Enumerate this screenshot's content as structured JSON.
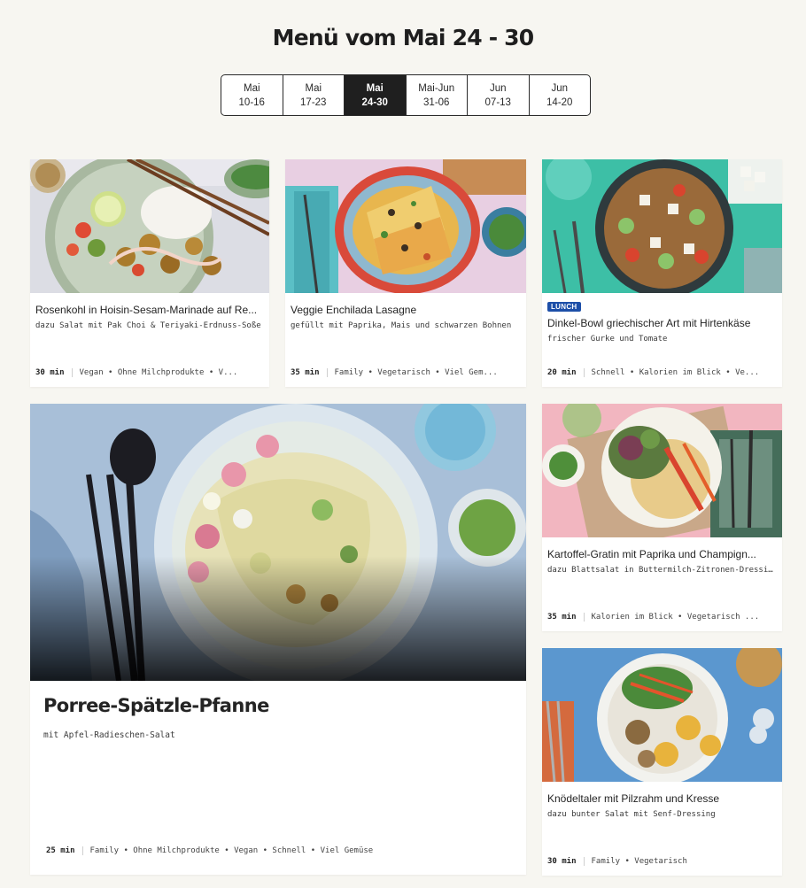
{
  "header": {
    "title": "Menü vom Mai 24 - 30"
  },
  "weeks": [
    {
      "month": "Mai",
      "range": "10-16",
      "active": false
    },
    {
      "month": "Mai",
      "range": "17-23",
      "active": false
    },
    {
      "month": "Mai",
      "range": "24-30",
      "active": true
    },
    {
      "month": "Mai-Jun",
      "range": "31-06",
      "active": false
    },
    {
      "month": "Jun",
      "range": "07-13",
      "active": false
    },
    {
      "month": "Jun",
      "range": "14-20",
      "active": false
    }
  ],
  "recipes": {
    "rosenkohl": {
      "title": "Rosenkohl in Hoisin-Sesam-Marinade auf Re...",
      "subtitle": "dazu Salat mit Pak Choi & Teriyaki-Erdnuss-Soße",
      "time": "30 min",
      "tags": "Vegan • Ohne Milchprodukte • V..."
    },
    "enchilada": {
      "title": "Veggie Enchilada Lasagne",
      "subtitle": "gefüllt mit Paprika, Mais und schwarzen Bohnen",
      "time": "35 min",
      "tags": "Family • Vegetarisch • Viel Gem..."
    },
    "dinkel": {
      "badge": "LUNCH",
      "title": "Dinkel-Bowl griechischer Art mit Hirtenkäse",
      "subtitle": "frischer Gurke und Tomate",
      "time": "20 min",
      "tags": "Schnell • Kalorien im Blick • Ve..."
    },
    "porree": {
      "title": "Porree-Spätzle-Pfanne",
      "subtitle": "mit Apfel-Radieschen-Salat",
      "time": "25 min",
      "tags": "Family • Ohne Milchprodukte • Vegan • Schnell • Viel Gemüse"
    },
    "kartoffel": {
      "title": "Kartoffel-Gratin mit Paprika und Champign...",
      "subtitle": "dazu Blattsalat in Buttermilch-Zitronen-Dressing",
      "time": "35 min",
      "tags": "Kalorien im Blick • Vegetarisch ..."
    },
    "knoedel": {
      "title": "Knödeltaler mit Pilzrahm und Kresse",
      "subtitle": "dazu bunter Salat mit Senf-Dressing",
      "time": "30 min",
      "tags": "Family • Vegetarisch"
    }
  }
}
